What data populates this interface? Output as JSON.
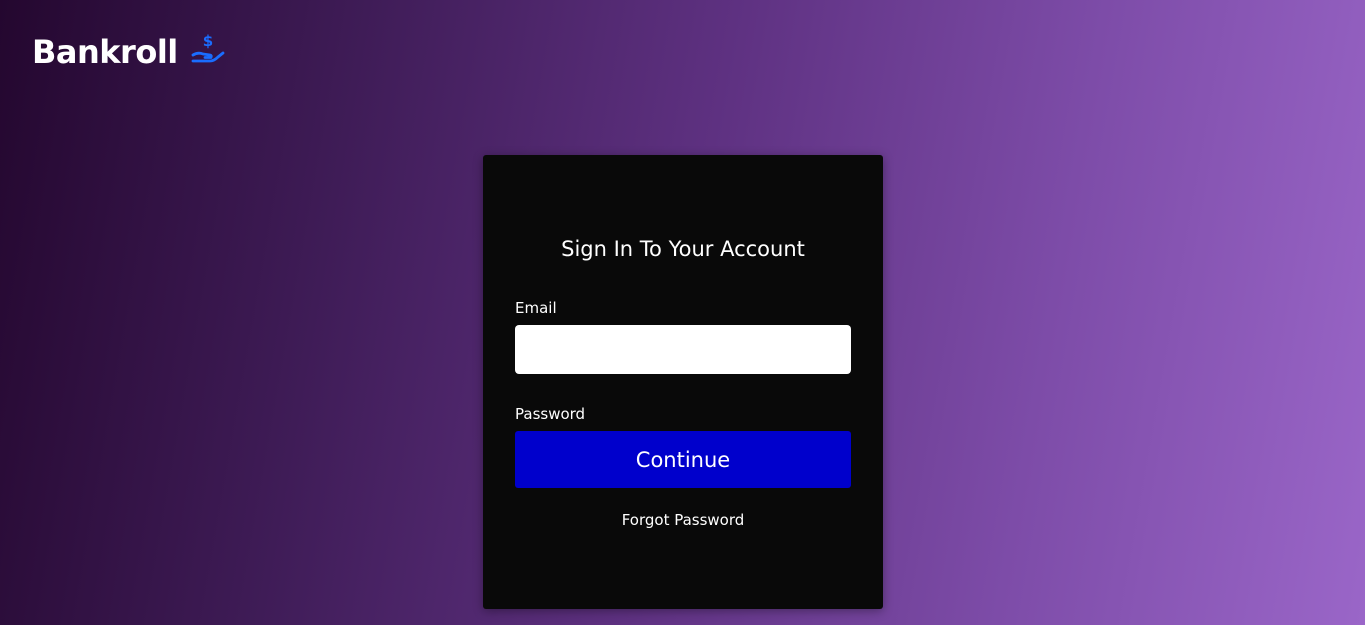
{
  "brand": {
    "name": "Bankroll",
    "icon": "hand-dollar-icon",
    "icon_color": "#1a6dff"
  },
  "login": {
    "title": "Sign In To Your Account",
    "email_label": "Email",
    "email_value": "",
    "password_label": "Password",
    "submit_label": "Continue",
    "forgot_label": "Forgot Password"
  },
  "colors": {
    "button": "#0000cc",
    "card": "#090909",
    "gradient_start": "#24072f",
    "gradient_end": "#9a66c8"
  }
}
